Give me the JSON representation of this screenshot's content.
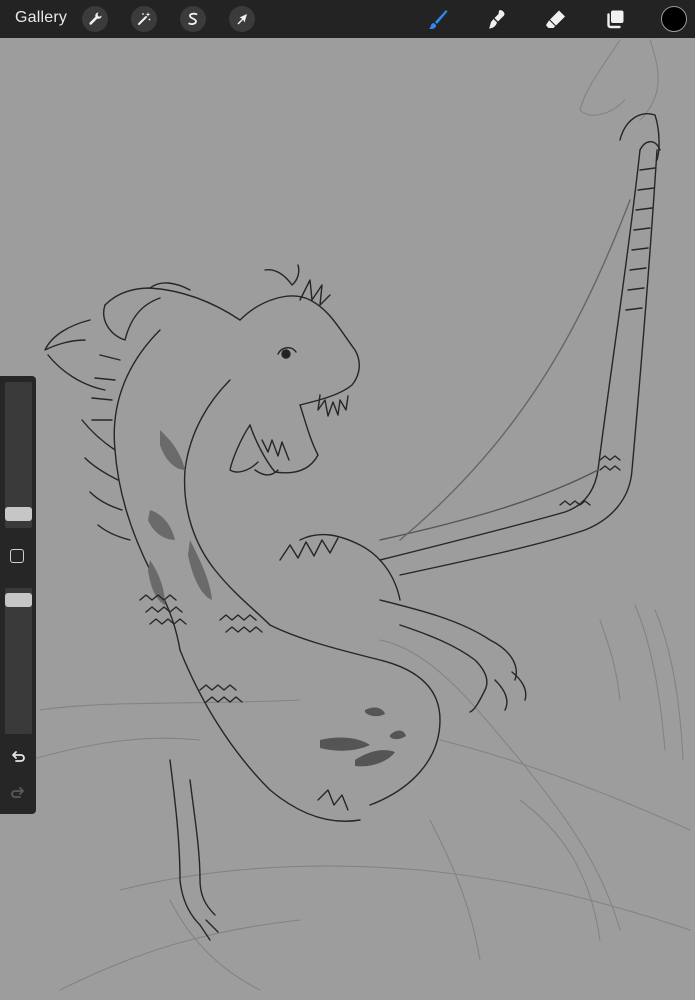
{
  "toolbar": {
    "gallery_label": "Gallery",
    "left_tools": [
      {
        "name": "actions",
        "icon": "wrench-icon"
      },
      {
        "name": "adjustments",
        "icon": "magic-wand-icon"
      },
      {
        "name": "selection",
        "icon": "selection-s-icon"
      },
      {
        "name": "transform",
        "icon": "cursor-arrow-icon"
      }
    ],
    "right_tools": [
      {
        "name": "brush",
        "icon": "brush-icon",
        "active": true
      },
      {
        "name": "smudge",
        "icon": "smudge-icon",
        "active": false
      },
      {
        "name": "eraser",
        "icon": "eraser-icon",
        "active": false
      },
      {
        "name": "layers",
        "icon": "layers-icon",
        "active": false
      }
    ],
    "current_color": "#000000",
    "active_color": "#2e8bf0"
  },
  "sidebar": {
    "brush_size_level": 0.05,
    "opacity_level": 0.96,
    "modify_icon": "square-modify-icon",
    "undo_icon": "undo-icon",
    "redo_icon": "redo-icon"
  },
  "canvas": {
    "background": "#9d9d9d",
    "artwork": "dragon-sketch"
  }
}
